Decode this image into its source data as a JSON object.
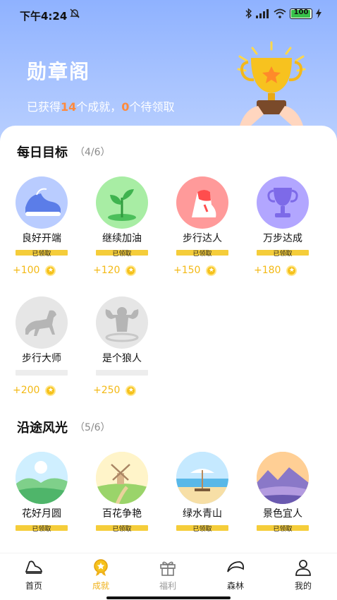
{
  "status": {
    "time": "下午4:24",
    "battery": "100"
  },
  "header": {
    "title": "勋章阁",
    "sub_prefix": "已获得",
    "earned": "14",
    "sub_mid": "个成就，",
    "pending": "0",
    "sub_suffix": "个待领取"
  },
  "daily": {
    "title": "每日目标",
    "count": "（4/6）",
    "items": [
      {
        "name": "良好开端",
        "status": "已领取",
        "reward": "+100",
        "icon": "shoe-icon"
      },
      {
        "name": "继续加油",
        "status": "已领取",
        "reward": "+120",
        "icon": "sprout-icon"
      },
      {
        "name": "步行达人",
        "status": "已领取",
        "reward": "+150",
        "icon": "sneaker-icon"
      },
      {
        "name": "万步达成",
        "status": "已领取",
        "reward": "+180",
        "icon": "trophy-icon"
      },
      {
        "name": "步行大师",
        "status": "",
        "reward": "+200",
        "icon": "horse-icon"
      },
      {
        "name": "是个狼人",
        "status": "",
        "reward": "+250",
        "icon": "strongman-icon"
      }
    ]
  },
  "scenery": {
    "title": "沿途风光",
    "count": "（5/6）",
    "items": [
      {
        "name": "花好月圆",
        "status": "已领取",
        "icon": "hills-icon"
      },
      {
        "name": "百花争艳",
        "status": "已领取",
        "icon": "windmill-icon"
      },
      {
        "name": "绿水青山",
        "status": "已领取",
        "icon": "beach-icon"
      },
      {
        "name": "景色宜人",
        "status": "已领取",
        "icon": "mountain-sunset-icon"
      }
    ]
  },
  "tabs": [
    {
      "label": "首页",
      "icon": "sneaker-icon"
    },
    {
      "label": "成就",
      "icon": "medal-icon"
    },
    {
      "label": "福利",
      "icon": "gift-icon"
    },
    {
      "label": "森林",
      "icon": "leaf-icon"
    },
    {
      "label": "我的",
      "icon": "user-icon"
    }
  ],
  "colors": {
    "accent": "#f0b21b",
    "header": "#9dbcff",
    "reward": "#f3b915",
    "claimed_bar": "#f5cd3a"
  }
}
